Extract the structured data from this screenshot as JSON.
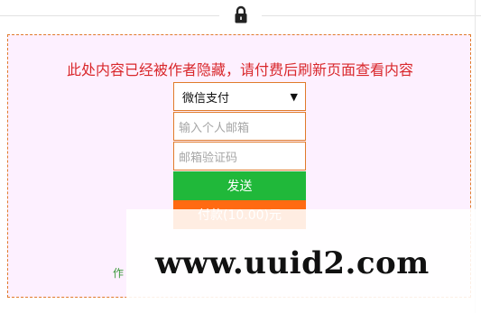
{
  "header": {
    "lock_icon": "lock-icon"
  },
  "paywall": {
    "notice": "此处内容已经被作者隐藏，请付费后刷新页面查看内容",
    "payment_method": {
      "selected": "微信支付"
    },
    "email_placeholder": "输入个人邮箱",
    "code_placeholder": "邮箱验证码",
    "send_label": "发送",
    "pay_label": "付款(10.00)元",
    "author_note": "作"
  },
  "watermark": {
    "text": "www.uuid2.com"
  },
  "colors": {
    "accent_border": "#e07b2b",
    "notice_text": "#d9282c",
    "send_button": "#20b83a",
    "pay_button": "#ff6a12",
    "panel_bg": "#fdf0ff"
  }
}
